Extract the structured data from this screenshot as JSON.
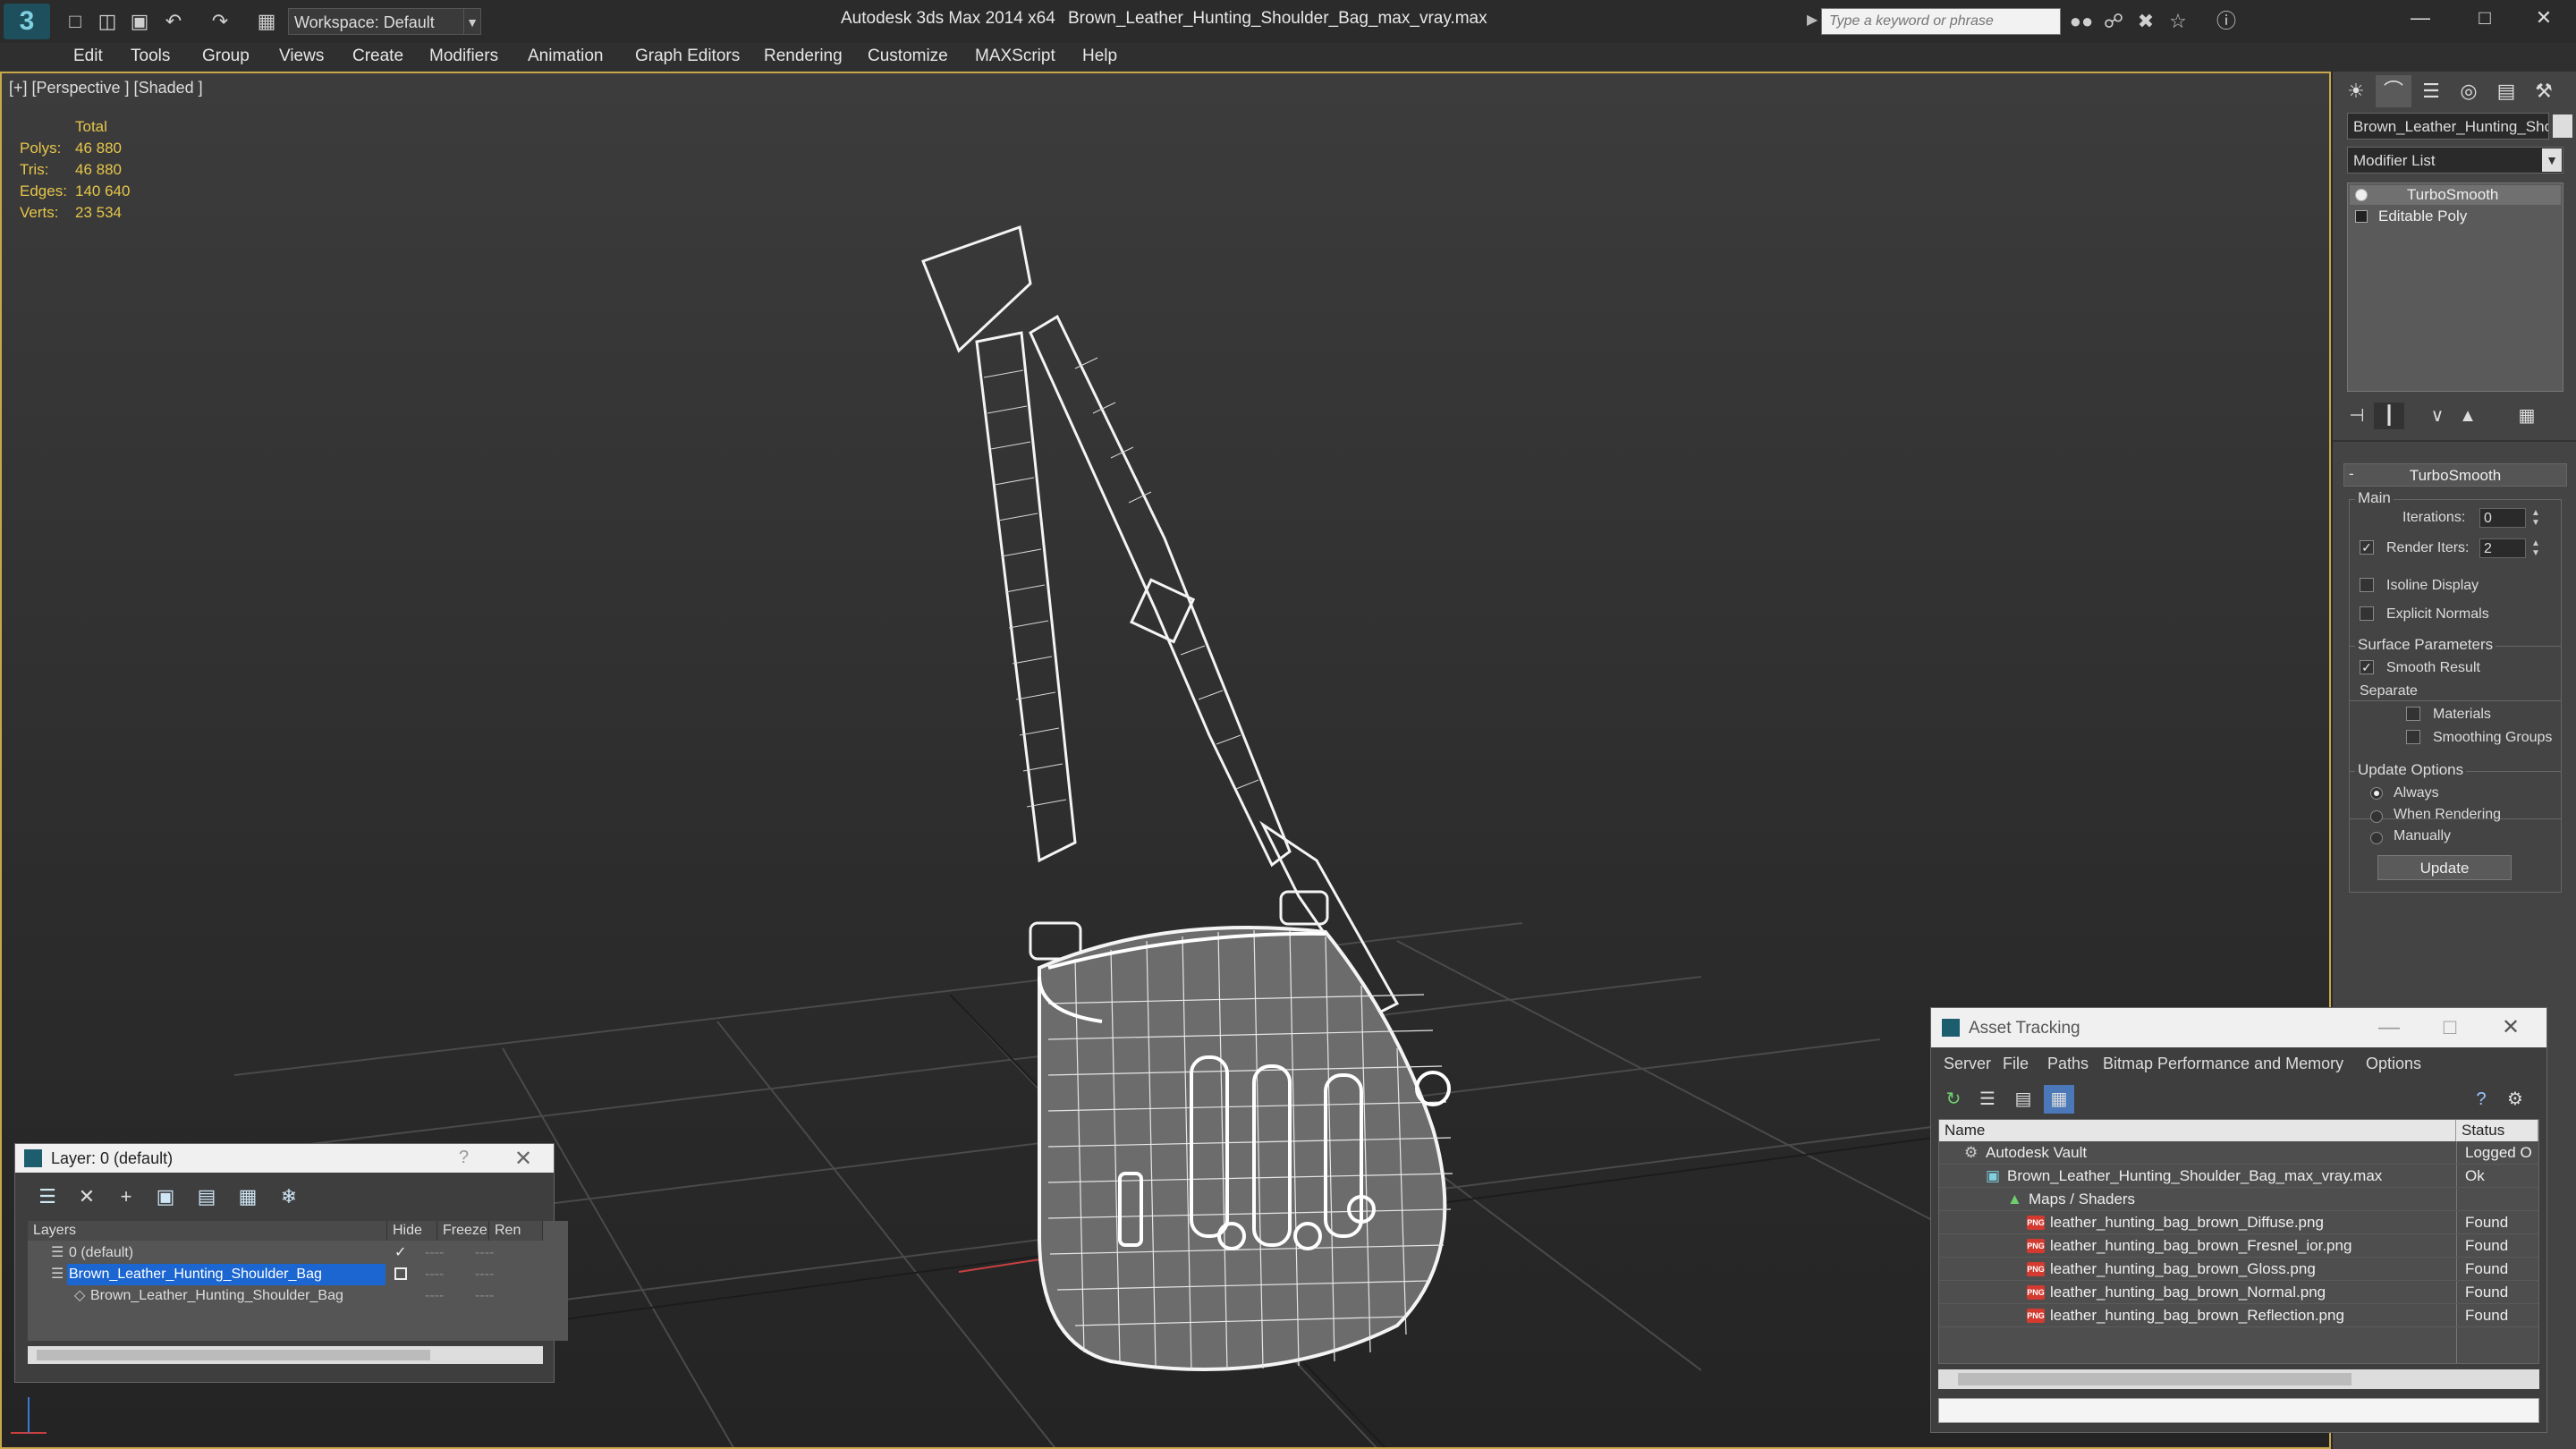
{
  "titlebar": {
    "workspace": "Workspace: Default",
    "app_title": "Autodesk 3ds Max  2014 x64",
    "doc_title": "Brown_Leather_Hunting_Shoulder_Bag_max_vray.max",
    "search_placeholder": "Type a keyword or phrase"
  },
  "menu": [
    "Edit",
    "Tools",
    "Group",
    "Views",
    "Create",
    "Modifiers",
    "Animation",
    "Graph Editors",
    "Rendering",
    "Customize",
    "MAXScript",
    "Help"
  ],
  "viewport": {
    "label": "[+] [Perspective ] [Shaded ]",
    "stats": {
      "header": "Total",
      "rows": [
        {
          "label": "Polys:",
          "value": "46 880"
        },
        {
          "label": "Tris:",
          "value": "46 880"
        },
        {
          "label": "Edges:",
          "value": "140 640"
        },
        {
          "label": "Verts:",
          "value": "23 534"
        }
      ]
    }
  },
  "command_panel": {
    "object_name": "Brown_Leather_Hunting_Sho",
    "modifier_list": "Modifier List",
    "stack": [
      "TurboSmooth",
      "Editable Poly"
    ],
    "turbosmooth": {
      "header": "TurboSmooth",
      "main_group": "Main",
      "iterations_label": "Iterations:",
      "iterations_value": "0",
      "render_iters_label": "Render Iters:",
      "render_iters_value": "2",
      "isoline": "Isoline Display",
      "explicit_normals": "Explicit Normals",
      "surface_group": "Surface Parameters",
      "smooth_result": "Smooth Result",
      "separate": "Separate",
      "materials": "Materials",
      "smoothing_groups": "Smoothing Groups",
      "update_group": "Update Options",
      "always": "Always",
      "when_rendering": "When Rendering",
      "manually": "Manually",
      "update_button": "Update"
    }
  },
  "layer_dialog": {
    "title": "Layer: 0 (default)",
    "help": "?",
    "columns": [
      "Layers",
      "Hide",
      "Freeze",
      "Ren"
    ],
    "rows": [
      {
        "name": "0 (default)"
      },
      {
        "name": "Brown_Leather_Hunting_Shoulder_Bag"
      },
      {
        "name": "Brown_Leather_Hunting_Shoulder_Bag"
      }
    ],
    "dash": "----"
  },
  "asset_dialog": {
    "title": "Asset Tracking",
    "menu": [
      "Server",
      "File",
      "Paths",
      "Bitmap Performance and Memory",
      "Options"
    ],
    "columns": [
      "Name",
      "Status"
    ],
    "rows": [
      {
        "name": "Autodesk Vault",
        "status": "Logged O"
      },
      {
        "name": "Brown_Leather_Hunting_Shoulder_Bag_max_vray.max",
        "status": "Ok"
      },
      {
        "name": "Maps / Shaders",
        "status": ""
      },
      {
        "name": "leather_hunting_bag_brown_Diffuse.png",
        "status": "Found"
      },
      {
        "name": "leather_hunting_bag_brown_Fresnel_ior.png",
        "status": "Found"
      },
      {
        "name": "leather_hunting_bag_brown_Gloss.png",
        "status": "Found"
      },
      {
        "name": "leather_hunting_bag_brown_Normal.png",
        "status": "Found"
      },
      {
        "name": "leather_hunting_bag_brown_Reflection.png",
        "status": "Found"
      }
    ],
    "png_badge": "PNG"
  },
  "colors": {
    "viewport_border": "#c8a84a",
    "stats_text": "#e6c64a",
    "selection": "#1b66d0",
    "png_icon": "#d43a2f"
  }
}
